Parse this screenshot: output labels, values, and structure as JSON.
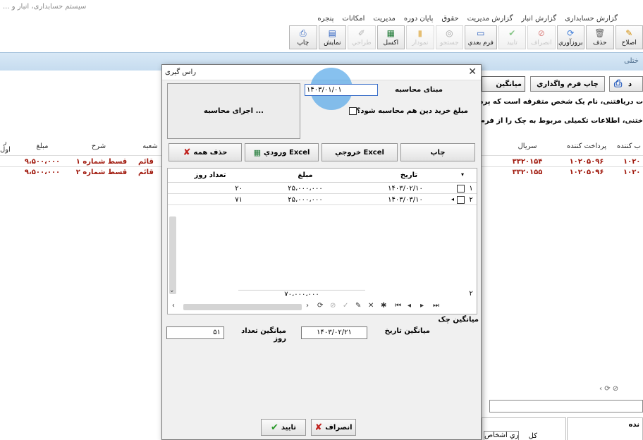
{
  "app": {
    "title": "سیستم حسابداری، انبار و ..."
  },
  "menu": [
    "گزارش حسابداری",
    "گزارش انبار",
    "گزارش مدیریت",
    "حقوق",
    "پایان دوره",
    "مدیریت",
    "امکانات",
    "پنجره"
  ],
  "toolbar": [
    {
      "label": "اصلاح",
      "icon": "pencil-icon",
      "enabled": true
    },
    {
      "label": "حذف",
      "icon": "trash-icon",
      "enabled": true
    },
    {
      "label": "بروزآوري",
      "icon": "refresh-icon",
      "enabled": true
    },
    {
      "label": "انصراف",
      "icon": "cancel-icon",
      "enabled": false
    },
    {
      "label": "تایید",
      "icon": "check-icon",
      "enabled": false
    },
    {
      "label": "فرم بعدي",
      "icon": "monitor-icon",
      "enabled": true
    },
    {
      "label": "جستجو",
      "icon": "binoculars-icon",
      "enabled": false
    },
    {
      "label": "نمودار",
      "icon": "chart-icon",
      "enabled": false
    },
    {
      "label": "اكسل",
      "icon": "excel-icon",
      "enabled": true
    },
    {
      "label": "طراحي",
      "icon": "brush-icon",
      "enabled": false
    },
    {
      "label": "نمایش",
      "icon": "preview-icon",
      "enabled": true
    },
    {
      "label": "چاپ",
      "icon": "printer-icon",
      "enabled": true
    }
  ],
  "background": {
    "strip_text": "ختلی",
    "btn_print_form": "چاپ فرم واگذاري",
    "btn_avg": "میانگین",
    "btn_print": "د",
    "info_line1": "ت دریافتنی، نام یک شخص متفرقه است که پرداخ",
    "info_line2": "ختنی، اطلاعات تکمیلی مربوط به چک را از فرم ر",
    "grid_headers": [
      "شعبه",
      "شرح",
      "مبلغ",
      "سريال",
      "پرداخت کننده",
      "ب کننده"
    ],
    "left_header": [
      "ر",
      "اول"
    ],
    "rows": [
      {
        "shobe": "قائم",
        "sharh": "قسط شماره ۱",
        "mablagh": "۹،۵۰۰،۰۰۰",
        "serial": "۳۳۲۰۱۵۴",
        "pardakht": "۱۰۲۰۵۰۹۶",
        "tail": "۱۰۲۰"
      },
      {
        "shobe": "قائم",
        "sharh": "قسط شماره ۲",
        "mablagh": "۹،۵۰۰،۰۰۰",
        "serial": "۳۳۲۰۱۵۵",
        "pardakht": "۱۰۲۰۵۰۹۶",
        "tail": "۱۰۲۰"
      }
    ],
    "bottom_label": "نده",
    "bottom_combo": "جاري اشخاص",
    "bottom_combo_label": "كل"
  },
  "dialog": {
    "title": "راس گیری",
    "calc_button": "اجرای محاسبه ...",
    "basis_label": "مبنای محاسبه",
    "basis_value": "۱۴۰۳/۰۱/۰۱",
    "checkbox_label": "مبلغ خرید دین هم محاسبه شود؟",
    "checkbox_checked": false,
    "btn_print": "چاپ",
    "btn_excel_out": "خروجي Excel",
    "btn_excel_in": "ورودي Excel",
    "btn_delete_all": "حذف همه",
    "grid_headers": {
      "date": "تاریخ",
      "amount": "مبلغ",
      "days": "تعداد روز"
    },
    "rows": [
      {
        "n": "۱",
        "date": "۱۴۰۳/۰۲/۱۰",
        "amount": "۲۵،۰۰۰،۰۰۰",
        "days": "۲۰"
      },
      {
        "n": "۲",
        "date": "۱۴۰۳/۰۳/۱۰",
        "amount": "۲۵،۰۰۰،۰۰۰",
        "days": "۷۱"
      }
    ],
    "sum_amount": "۷۰،۰۰۰،۰۰۰",
    "row_count": "۲",
    "avg_check_label": "میانگین چک",
    "avg_date_label": "میانگین تاریخ",
    "avg_date_value": "۱۴۰۳/۰۲/۲۱",
    "avg_days_label": "میانگین تعداد روز",
    "avg_days_value": "۵۱",
    "btn_cancel": "انصراف",
    "btn_ok": "تایید"
  },
  "colors": {
    "accent_blue": "#3a6fc9",
    "amount_red": "#a0180c",
    "ok_green": "#2a9a2a",
    "cancel_red": "#c0201c"
  }
}
